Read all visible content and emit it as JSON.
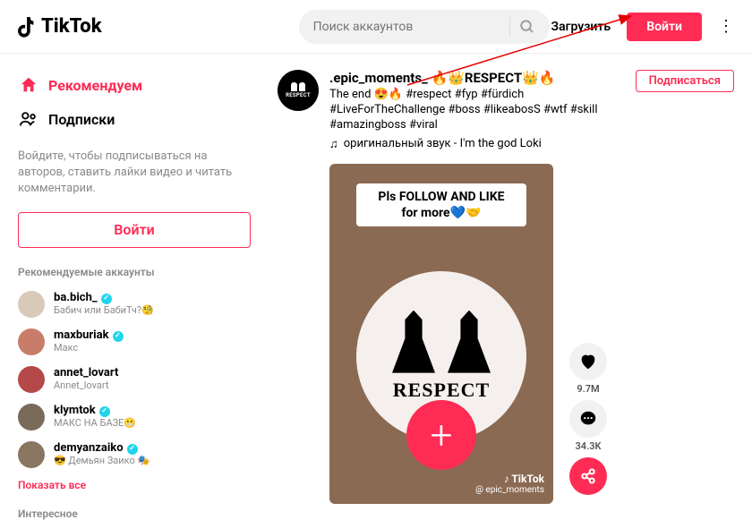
{
  "brand": "TikTok",
  "search": {
    "placeholder": "Поиск аккаунтов"
  },
  "header": {
    "upload": "Загрузить",
    "login": "Войти"
  },
  "sidebar": {
    "nav": {
      "recommended": "Рекомендуем",
      "following": "Подписки"
    },
    "login_prompt": "Войдите, чтобы подписываться на авторов, ставить лайки видео и читать комментарии.",
    "login_button": "Войти",
    "recommended_title": "Рекомендуемые аккаунты",
    "accounts": [
      {
        "name": "ba.bich_",
        "sub": "Бабич или БабиТч?🧐",
        "verified": true,
        "color": "#d8c9b8"
      },
      {
        "name": "maxburiak",
        "sub": "Макс",
        "verified": true,
        "color": "#c87d6a"
      },
      {
        "name": "annet_lovart",
        "sub": "Annet_lovart",
        "verified": false,
        "color": "#b54848"
      },
      {
        "name": "klymtok",
        "sub": "МАКС НА БАЗЕ😬",
        "verified": true,
        "color": "#7a6a5a"
      },
      {
        "name": "demyanzaiko",
        "sub": "😎 Демьян Заико 🎭",
        "verified": true,
        "color": "#8a7560"
      }
    ],
    "show_all": "Показать все",
    "interesting": "Интересное"
  },
  "post": {
    "author": ".epic_moments_",
    "title_suffix": " 🔥👑RESPECT👑🔥",
    "caption": "The end 😍🔥 #respect #fyp #fürdich #LiveForTheChallenge #boss #likeabosS #wtf #skill #amazingboss #viral",
    "sound": "оригинальный звук - I'm the god Loki",
    "subscribe": "Подписаться",
    "avatar_text": "RESPECT",
    "video": {
      "banner_l1": "Pls FOLLOW AND LIKE",
      "banner_l2": "for more💙🤝",
      "respect": "RESPECT",
      "watermark_handle": "@ epic_moments"
    },
    "actions": {
      "likes": "9.7M",
      "comments": "34.3K"
    }
  }
}
